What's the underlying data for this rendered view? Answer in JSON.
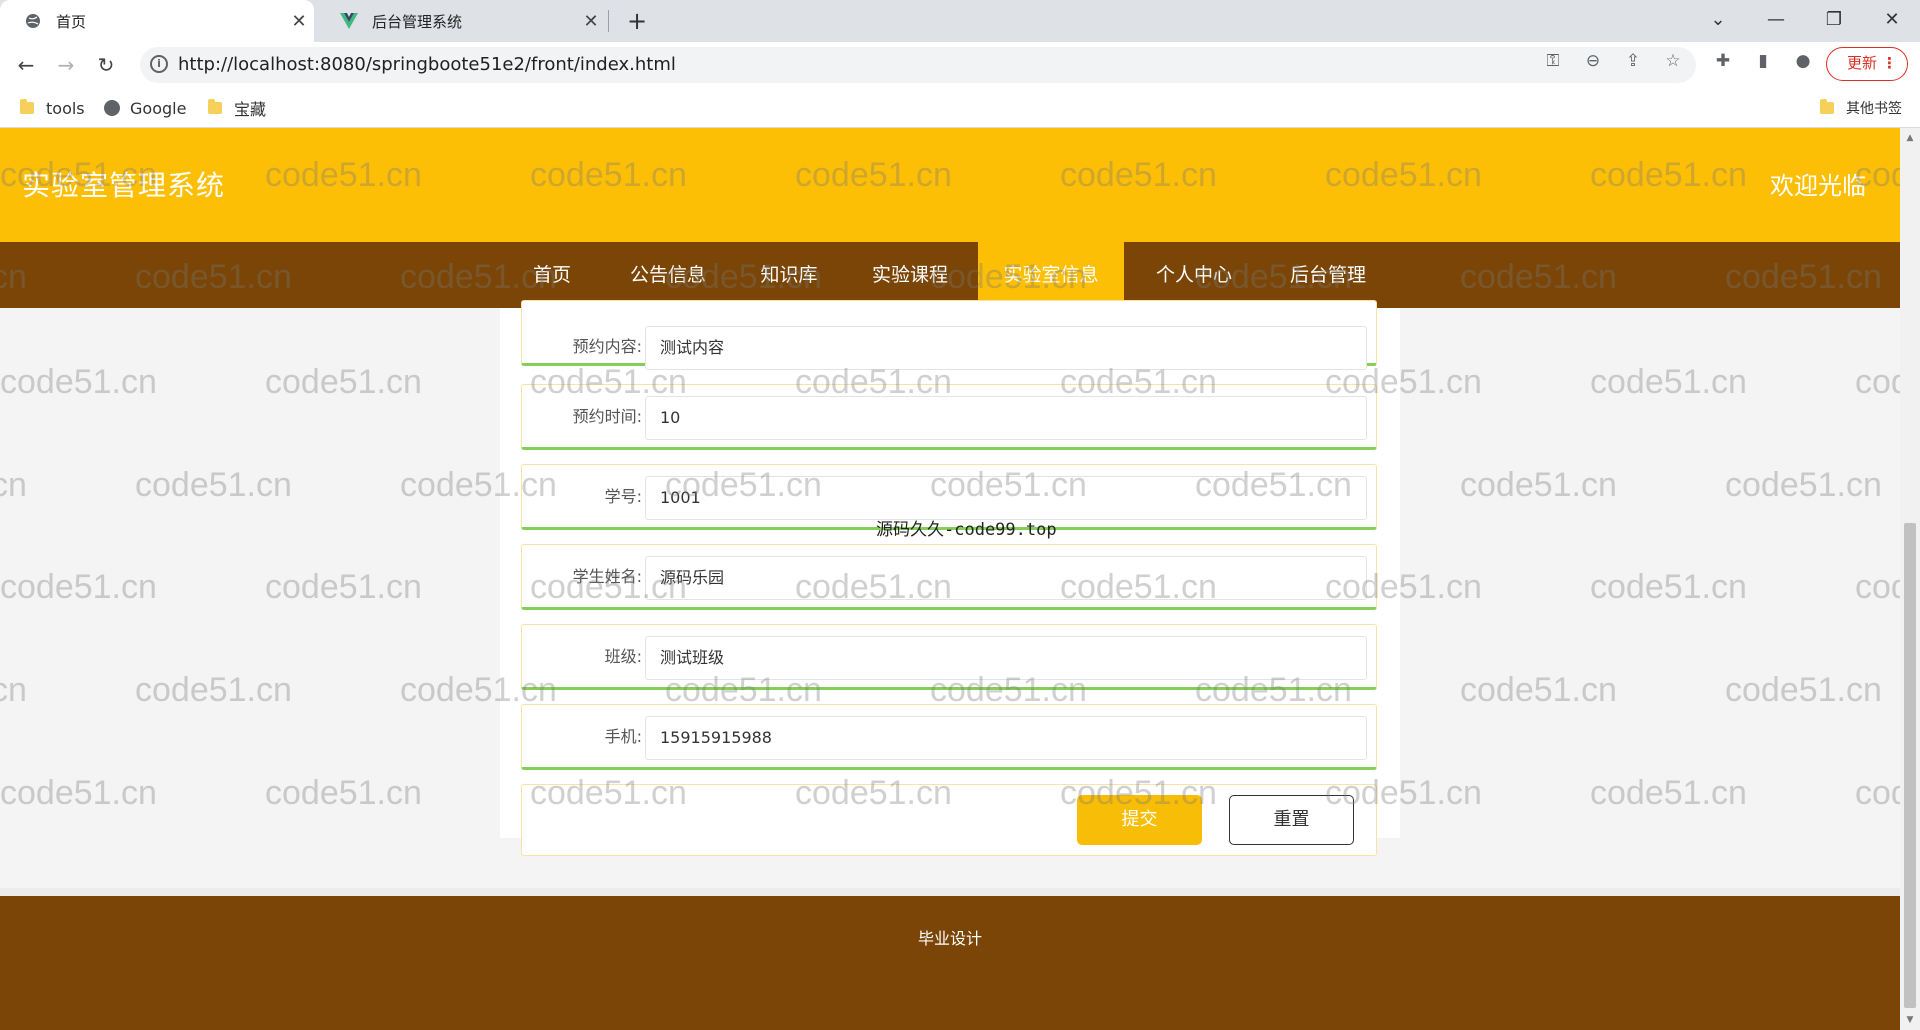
{
  "browser": {
    "tabs": [
      {
        "title": "首页",
        "active": true
      },
      {
        "title": "后台管理系统",
        "active": false
      }
    ],
    "url": "http://localhost:8080/springboote51e2/front/index.html",
    "update_label": "更新",
    "bookmarks": [
      {
        "label": "tools",
        "icon": "folder-icon"
      },
      {
        "label": "Google",
        "icon": "globe-icon"
      },
      {
        "label": "宝藏",
        "icon": "folder-icon"
      }
    ],
    "other_bookmarks": "其他书签"
  },
  "site": {
    "title": "实验室管理系统",
    "welcome": "欢迎光临",
    "nav": [
      "首页",
      "公告信息",
      "知识库",
      "实验课程",
      "实验室信息",
      "个人中心",
      "后台管理"
    ],
    "active_nav": "实验室信息"
  },
  "form": {
    "rows": [
      {
        "label": "预约内容:",
        "value": "测试内容"
      },
      {
        "label": "预约时间:",
        "value": "10"
      },
      {
        "label": "学号:",
        "value": "1001"
      },
      {
        "label": "学生姓名:",
        "value": "源码乐园"
      },
      {
        "label": "班级:",
        "value": "测试班级"
      },
      {
        "label": "手机:",
        "value": "15915915988"
      }
    ],
    "submit_label": "提交",
    "reset_label": "重置"
  },
  "overlay_text": "源码久久-code99.top",
  "footer": "毕业设计",
  "watermark": "code51.cn",
  "colors": {
    "header": "#fdbf06",
    "nav": "#7a4506",
    "row_border_accent": "#86cf57",
    "submit": "#f7bd07"
  }
}
